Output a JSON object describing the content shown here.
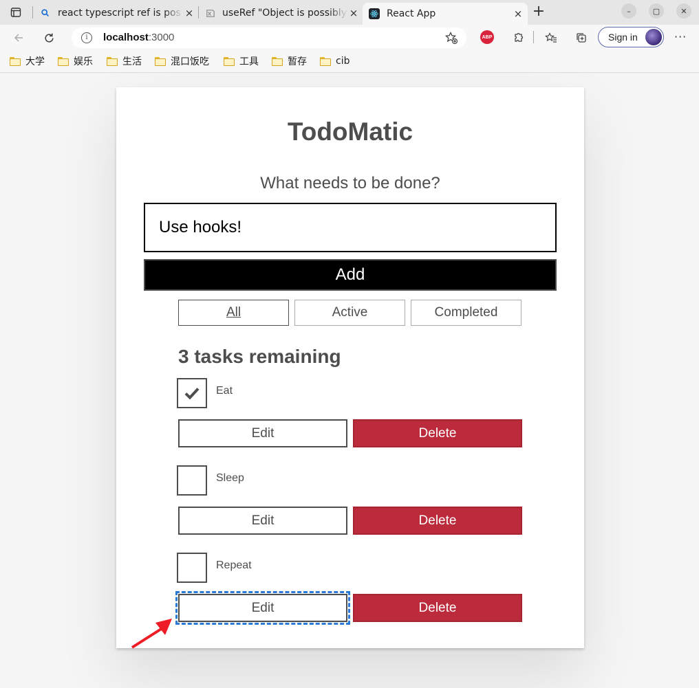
{
  "browser": {
    "tabs": [
      {
        "title": "react typescript ref is pos",
        "favicon": "search-icon"
      },
      {
        "title": "useRef \"Object is possibly",
        "favicon": "stack-icon"
      },
      {
        "title": "React App",
        "favicon": "react-icon"
      }
    ],
    "address": {
      "host": "localhost",
      "port": ":3000"
    },
    "signin_label": "Sign in",
    "bookmarks": [
      "大学",
      "娱乐",
      "生活",
      "混口饭吃",
      "工具",
      "暂存",
      "cib"
    ]
  },
  "app": {
    "title": "TodoMatic",
    "prompt": "What needs to be done?",
    "input_value": "Use hooks!",
    "add_label": "Add",
    "filters": [
      "All",
      "Active",
      "Completed"
    ],
    "heading": "3 tasks remaining",
    "todos": [
      {
        "name": "Eat",
        "completed": true
      },
      {
        "name": "Sleep",
        "completed": false
      },
      {
        "name": "Repeat",
        "completed": false
      }
    ],
    "edit_label": "Edit",
    "delete_label": "Delete"
  },
  "colors": {
    "delete_bg": "#bb2b3b",
    "focus_outline": "#2b7bd6",
    "annotation_arrow": "#ee1c24"
  }
}
